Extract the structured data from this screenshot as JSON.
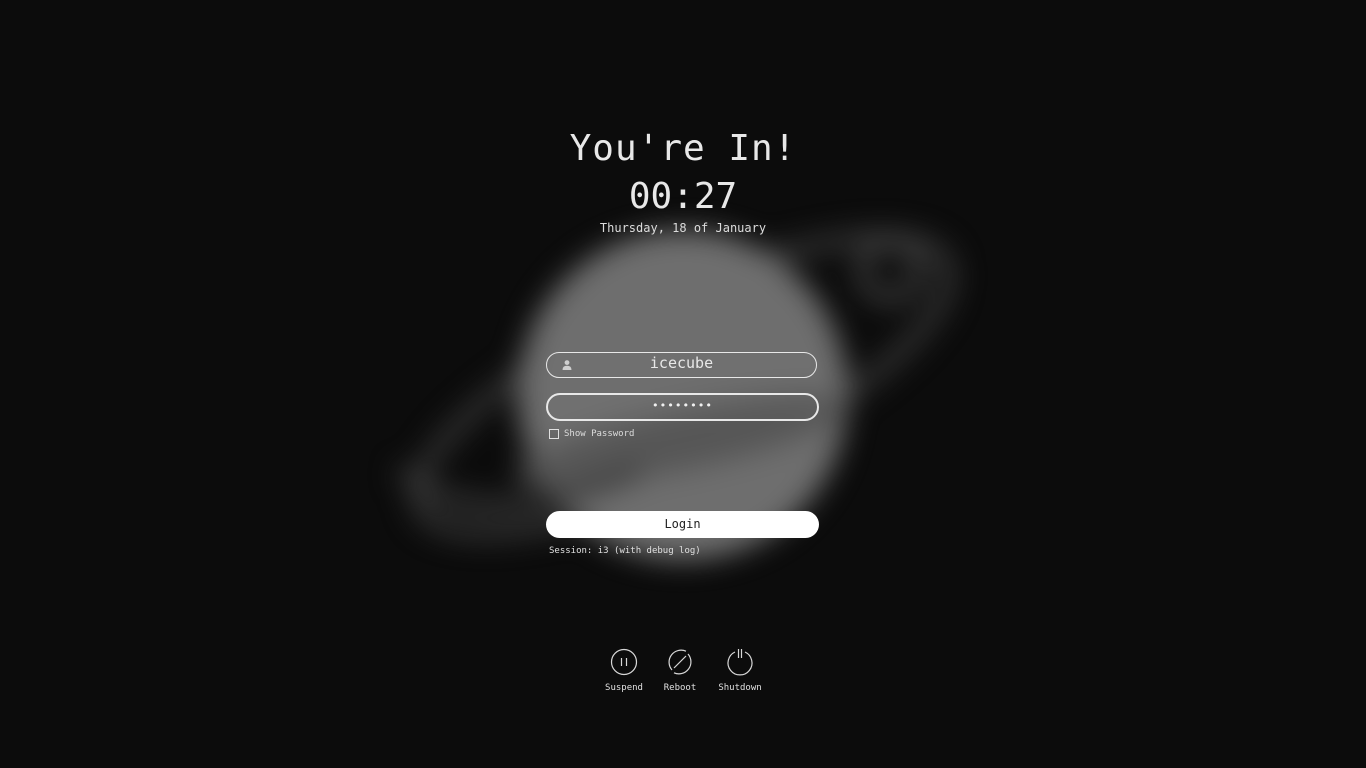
{
  "greeter": {
    "headline": "You're In!",
    "time": "00:27",
    "date": "Thursday, 18 of January"
  },
  "form": {
    "username": "icecube",
    "password_masked": "••••••••",
    "show_password_label": "Show Password",
    "show_password_checked": false,
    "login_label": "Login",
    "session_text": "Session: i3 (with debug log)"
  },
  "power": {
    "suspend_label": "Suspend",
    "reboot_label": "Reboot",
    "shutdown_label": "Shutdown"
  },
  "icons": {
    "user": "user-icon",
    "suspend": "pause-icon",
    "reboot": "reboot-icon",
    "shutdown": "power-icon"
  },
  "colors": {
    "background": "#0c0c0c",
    "foreground": "#e6e6e6",
    "button_bg": "#ffffff",
    "button_fg": "#222222"
  }
}
